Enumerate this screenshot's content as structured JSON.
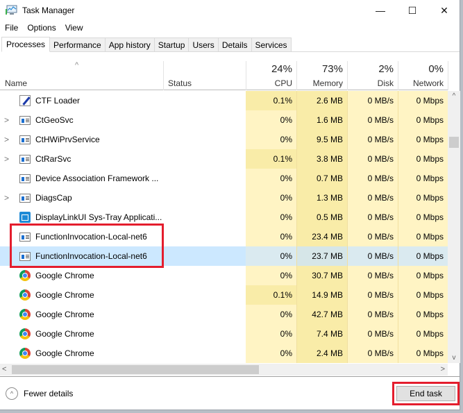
{
  "window": {
    "title": "Task Manager",
    "controls": {
      "minimize": "—",
      "maximize": "☐",
      "close": "✕"
    }
  },
  "menu": [
    "File",
    "Options",
    "View"
  ],
  "tabs": [
    {
      "label": "Processes",
      "active": true
    },
    {
      "label": "Performance",
      "active": false
    },
    {
      "label": "App history",
      "active": false
    },
    {
      "label": "Startup",
      "active": false
    },
    {
      "label": "Users",
      "active": false
    },
    {
      "label": "Details",
      "active": false
    },
    {
      "label": "Services",
      "active": false
    }
  ],
  "columns": {
    "name": "Name",
    "status": "Status",
    "cpu": {
      "label": "CPU",
      "total": "24%"
    },
    "memory": {
      "label": "Memory",
      "total": "73%"
    },
    "disk": {
      "label": "Disk",
      "total": "2%"
    },
    "network": {
      "label": "Network",
      "total": "0%"
    },
    "sort_indicator": "^"
  },
  "processes": [
    {
      "name": "CTF Loader",
      "icon": "ctf-loader-icon",
      "expandable": false,
      "status": "",
      "cpu": "0.1%",
      "memory": "2.6 MB",
      "disk": "0 MB/s",
      "network": "0 Mbps"
    },
    {
      "name": "CtGeoSvc",
      "icon": "service-icon",
      "expandable": true,
      "status": "",
      "cpu": "0%",
      "memory": "1.6 MB",
      "disk": "0 MB/s",
      "network": "0 Mbps"
    },
    {
      "name": "CtHWiPrvService",
      "icon": "service-icon",
      "expandable": true,
      "status": "",
      "cpu": "0%",
      "memory": "9.5 MB",
      "disk": "0 MB/s",
      "network": "0 Mbps"
    },
    {
      "name": "CtRarSvc",
      "icon": "service-icon",
      "expandable": true,
      "status": "",
      "cpu": "0.1%",
      "memory": "3.8 MB",
      "disk": "0 MB/s",
      "network": "0 Mbps"
    },
    {
      "name": "Device Association Framework ...",
      "icon": "service-icon",
      "expandable": false,
      "status": "",
      "cpu": "0%",
      "memory": "0.7 MB",
      "disk": "0 MB/s",
      "network": "0 Mbps"
    },
    {
      "name": "DiagsCap",
      "icon": "service-icon",
      "expandable": true,
      "status": "",
      "cpu": "0%",
      "memory": "1.3 MB",
      "disk": "0 MB/s",
      "network": "0 Mbps"
    },
    {
      "name": "DisplayLinkUI Sys-Tray Applicati...",
      "icon": "displaylink-icon",
      "expandable": false,
      "status": "",
      "cpu": "0%",
      "memory": "0.5 MB",
      "disk": "0 MB/s",
      "network": "0 Mbps"
    },
    {
      "name": "FunctionInvocation-Local-net6",
      "icon": "service-icon",
      "expandable": false,
      "status": "",
      "cpu": "0%",
      "memory": "23.4 MB",
      "disk": "0 MB/s",
      "network": "0 Mbps"
    },
    {
      "name": "FunctionInvocation-Local-net6",
      "icon": "service-icon",
      "expandable": false,
      "status": "",
      "cpu": "0%",
      "memory": "23.7 MB",
      "disk": "0 MB/s",
      "network": "0 Mbps",
      "selected": true
    },
    {
      "name": "Google Chrome",
      "icon": "chrome-icon",
      "expandable": false,
      "status": "",
      "cpu": "0%",
      "memory": "30.7 MB",
      "disk": "0 MB/s",
      "network": "0 Mbps"
    },
    {
      "name": "Google Chrome",
      "icon": "chrome-icon",
      "expandable": false,
      "status": "",
      "cpu": "0.1%",
      "memory": "14.9 MB",
      "disk": "0 MB/s",
      "network": "0 Mbps"
    },
    {
      "name": "Google Chrome",
      "icon": "chrome-icon",
      "expandable": false,
      "status": "",
      "cpu": "0%",
      "memory": "42.7 MB",
      "disk": "0 MB/s",
      "network": "0 Mbps"
    },
    {
      "name": "Google Chrome",
      "icon": "chrome-icon",
      "expandable": false,
      "status": "",
      "cpu": "0%",
      "memory": "7.4 MB",
      "disk": "0 MB/s",
      "network": "0 Mbps"
    },
    {
      "name": "Google Chrome",
      "icon": "chrome-icon",
      "expandable": false,
      "status": "",
      "cpu": "0%",
      "memory": "2.4 MB",
      "disk": "0 MB/s",
      "network": "0 Mbps"
    }
  ],
  "footer": {
    "fewer_details": "Fewer details",
    "end_task": "End task"
  },
  "scroll_glyphs": {
    "up": "^",
    "down": "v",
    "left": "<",
    "right": ">",
    "expander": ">"
  },
  "colors": {
    "highlight_box": "#e41d2d",
    "selected_row": "#cce8ff",
    "heat_light": "#fff4c4",
    "heat_medium": "#f9eca8"
  }
}
